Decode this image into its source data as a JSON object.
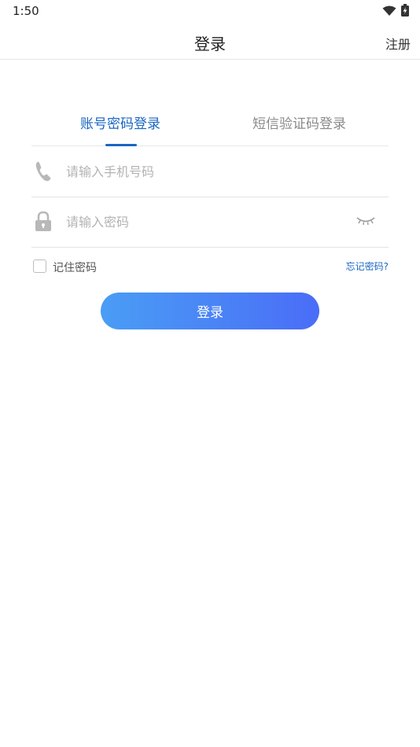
{
  "status_bar": {
    "time": "1:50",
    "icons": [
      "wifi-icon",
      "battery-charging-icon"
    ]
  },
  "header": {
    "title": "登录",
    "action": "注册"
  },
  "tabs": [
    {
      "label": "账号密码登录",
      "active": true
    },
    {
      "label": "短信验证码登录",
      "active": false
    }
  ],
  "form": {
    "phone": {
      "placeholder": "请输入手机号码",
      "value": "",
      "icon": "phone-icon"
    },
    "password": {
      "placeholder": "请输入密码",
      "value": "",
      "icon": "lock-icon",
      "toggle_icon": "eye-closed-icon"
    },
    "remember_label": "记住密码",
    "remember_checked": false,
    "forgot_label": "忘记密码?",
    "submit_label": "登录"
  },
  "colors": {
    "accent": "#1a66c2",
    "button_gradient_start": "#4a9df5",
    "button_gradient_end": "#4a6df7",
    "placeholder": "#b3b3b3"
  }
}
